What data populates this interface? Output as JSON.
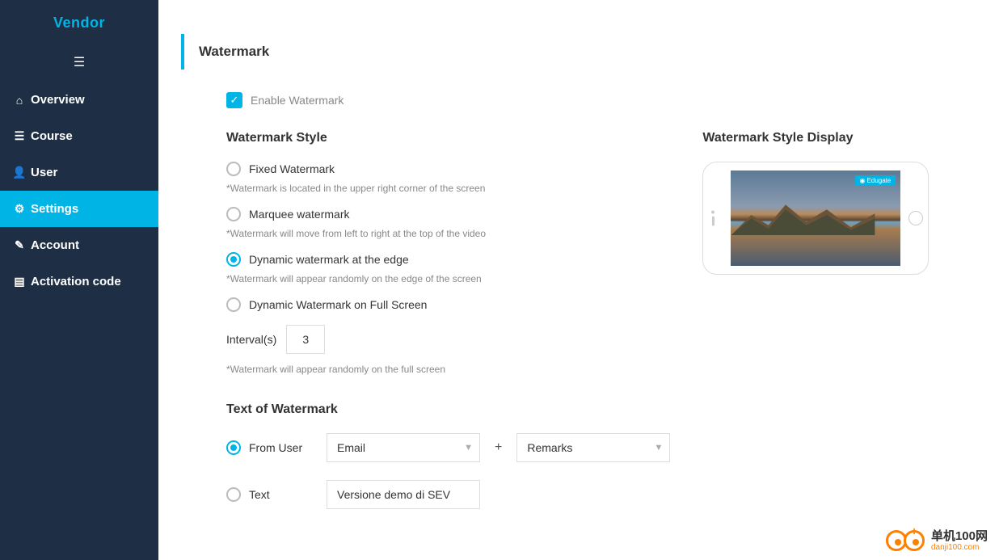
{
  "brand": "Vendor",
  "sidebar": {
    "items": [
      {
        "label": "Overview",
        "iconName": "home-icon",
        "glyph": "⌂"
      },
      {
        "label": "Course",
        "iconName": "sliders-icon",
        "glyph": "☰"
      },
      {
        "label": "User",
        "iconName": "user-icon",
        "glyph": "👤"
      },
      {
        "label": "Settings",
        "iconName": "gears-icon",
        "glyph": "⚙"
      },
      {
        "label": "Account",
        "iconName": "edit-icon",
        "glyph": "✎"
      },
      {
        "label": "Activation code",
        "iconName": "book-icon",
        "glyph": "▤"
      }
    ],
    "activeIndex": 3
  },
  "panel": {
    "title": "Watermark",
    "enable": {
      "label": "Enable Watermark",
      "checked": true
    },
    "style": {
      "heading": "Watermark Style",
      "options": [
        {
          "label": "Fixed Watermark",
          "hint": "*Watermark is located in the upper right corner of the screen",
          "checked": false
        },
        {
          "label": "Marquee watermark",
          "hint": "*Watermark will move from left to right at the top of the video",
          "checked": false
        },
        {
          "label": "Dynamic watermark at the edge",
          "hint": "*Watermark will appear randomly on the edge of the screen",
          "checked": true
        },
        {
          "label": "Dynamic Watermark on Full Screen",
          "hint": "",
          "checked": false
        }
      ],
      "interval": {
        "label": "Interval(s)",
        "value": "3",
        "hint": "*Watermark will appear randomly on the full screen"
      }
    },
    "textOf": {
      "heading": "Text of Watermark",
      "fromUser": {
        "label": "From User",
        "checked": true,
        "select1": "Email",
        "joiner": "+",
        "select2": "Remarks"
      },
      "text": {
        "label": "Text",
        "checked": false,
        "value": "Versione demo di SEV"
      }
    },
    "preview": {
      "heading": "Watermark Style Display",
      "badge": "Edugate"
    }
  },
  "footerLogo": {
    "text1": "单机100网",
    "text2": "danji100.com"
  },
  "colors": {
    "accent": "#00b4e6",
    "sidebarBg": "#1e2f45",
    "orange": "#ff7f00"
  }
}
